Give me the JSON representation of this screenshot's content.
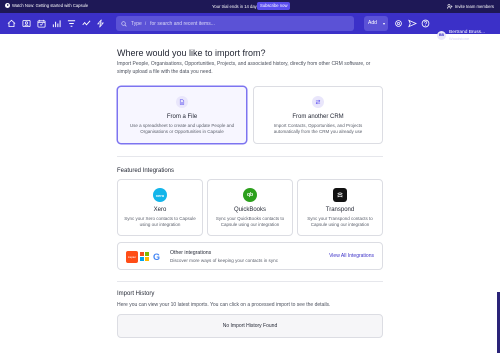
{
  "banner": {
    "watch_label": "Watch Now: Getting started with Capsule",
    "trial_text": "Your trial ends in 14 days",
    "subscribe_label": "Subscribe now",
    "invite_label": "Invite team members",
    "bg_color": "#1e1856"
  },
  "nav": {
    "bg_color": "#3b30c8",
    "icons": [
      "home-icon",
      "contacts-icon",
      "calendar-icon",
      "reports-icon",
      "pipeline-icon",
      "activity-icon",
      "workflow-icon"
    ],
    "search": {
      "shortcut": "/",
      "type_label": "Type",
      "placeholder": "for search and recent items..."
    },
    "add_label": "Add",
    "right_icons": [
      "settings-icon",
      "send-icon",
      "mail-icon",
      "help-icon"
    ],
    "user": {
      "initials": "BB",
      "name": "Bertrand Bruss...",
      "org": "Woodstone"
    }
  },
  "page": {
    "title": "Where would you like to import from?",
    "intro": "Import People, Organisations, Opportunities, Projects, and associated history, directly from other CRM software, or simply upload a file with the data you need.",
    "options": [
      {
        "title": "From a File",
        "description": "Use a spreadsheet to create and update People and Organisations or Opportunities in Capsule",
        "selected": true
      },
      {
        "title": "From another CRM",
        "description": "Import Contacts, Opportunities, and Projects automatically from the CRM you already use",
        "selected": false
      }
    ],
    "featured_heading": "Featured Integrations",
    "integrations": [
      {
        "name": "Xero",
        "logo_text": "xero",
        "color": "#13b5ea",
        "description": "Sync your Xero contacts to Capsule using our integration"
      },
      {
        "name": "QuickBooks",
        "logo_text": "qb",
        "color": "#2ca01c",
        "description": "Sync your QuickBooks contacts to Capsule using our integration"
      },
      {
        "name": "Transpond",
        "logo_text": "",
        "color": "#111111",
        "description": "Sync your Transpond contacts to Capsule using our integration"
      }
    ],
    "other": {
      "logo_text": "zapier",
      "google_glyph": "G",
      "title": "Other integrations",
      "description": "Discover more ways of keeping your contacts in sync",
      "link": "View All Integrations"
    },
    "history_heading": "Import History",
    "history_text": "Here you can view your 10 latest imports. You can click on a processed import to see the details.",
    "history_empty": "No Import History Found"
  }
}
